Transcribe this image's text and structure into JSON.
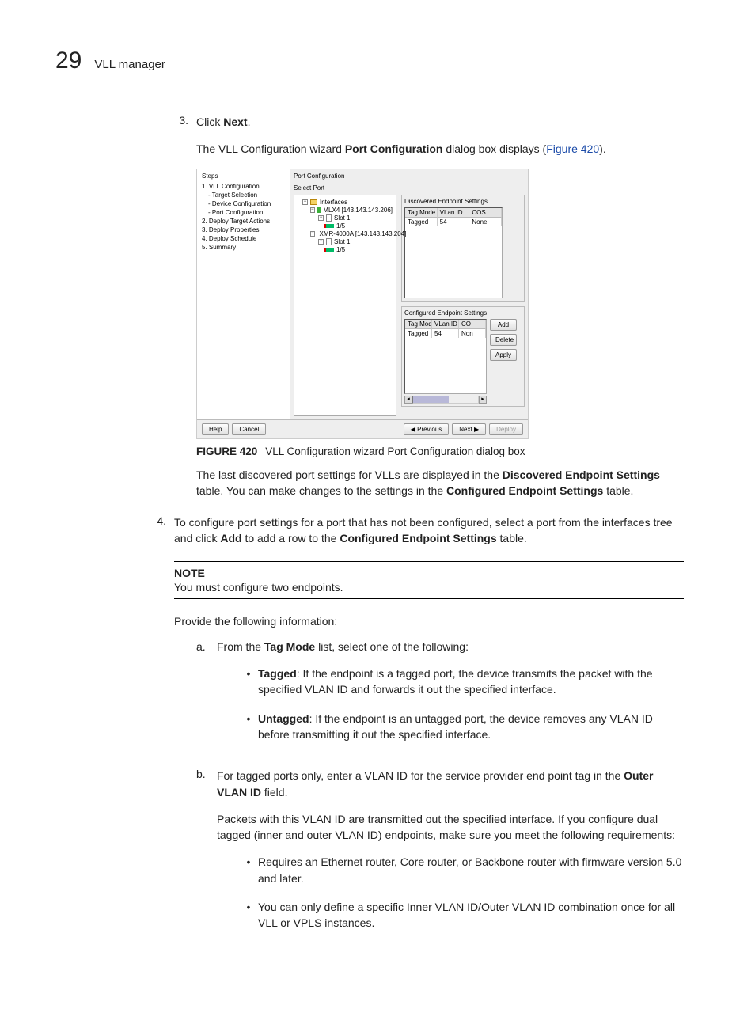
{
  "header": {
    "number": "29",
    "title": "VLL manager"
  },
  "step3": {
    "num": "3.",
    "line1_prefix": "Click ",
    "line1_bold": "Next",
    "line1_suffix": ".",
    "line2_a": "The VLL Configuration wizard ",
    "line2_b": "Port Configuration",
    "line2_c": " dialog box displays (",
    "line2_link": "Figure 420",
    "line2_d": ")."
  },
  "screenshot": {
    "steps_title": "Steps",
    "steps": [
      "1. VLL Configuration",
      "- Target Selection",
      "- Device Configuration",
      "- Port Configuration",
      "2. Deploy Target Actions",
      "3. Deploy Properties",
      "4. Deploy Schedule",
      "5. Summary"
    ],
    "right_title": "Port Configuration",
    "select_port": "Select Port",
    "tree": {
      "root": "Interfaces",
      "dev1": "MLX4 [143.143.143.206]",
      "slot1a": "Slot 1",
      "port1a": "1/5",
      "dev2": "XMR-4000A [143.143.143.204]",
      "slot1b": "Slot 1",
      "port1b": "1/5"
    },
    "disc_title": "Discovered Endpoint Settings",
    "conf_title": "Configured Endpoint Settings",
    "cols": {
      "tagmode": "Tag Mode",
      "vlanid": "VLan ID",
      "cos": "COS",
      "co": "CO"
    },
    "row": {
      "tagmode": "Tagged",
      "vlanid": "54",
      "cos": "None",
      "co": "Non"
    },
    "btns": {
      "add": "Add",
      "delete": "Delete",
      "apply": "Apply"
    },
    "bottom": {
      "help": "Help",
      "cancel": "Cancel",
      "prev": "◀ Previous",
      "next": "Next ▶",
      "deploy": "Deploy"
    }
  },
  "figcaption": {
    "num": "FIGURE 420",
    "text": "VLL Configuration wizard Port Configuration dialog box"
  },
  "para_after_fig": {
    "a": "The last discovered port settings for VLLs are displayed in the ",
    "b": "Discovered Endpoint Settings",
    "c": " table. You can make changes to the settings in the ",
    "d": "Configured Endpoint Settings",
    "e": " table."
  },
  "step4": {
    "num": "4.",
    "a": "To configure port settings for a port that has not been configured, select a port from the interfaces tree and click ",
    "b": "Add",
    "c": " to add a row to the ",
    "d": "Configured Endpoint Settings",
    "e": " table."
  },
  "note": {
    "title": "NOTE",
    "text": "You must configure two endpoints."
  },
  "provide": "Provide the following information:",
  "sub_a": {
    "letter": "a.",
    "a": "From the ",
    "b": "Tag Mode",
    "c": " list, select one of the following:"
  },
  "bullet_tagged": {
    "b": "Tagged",
    "t": ": If the endpoint is a tagged port, the device transmits the packet with the specified VLAN ID and forwards it out the specified interface."
  },
  "bullet_untagged": {
    "b": "Untagged",
    "t": ": If the endpoint is an untagged port, the device removes any VLAN ID before transmitting it out the specified interface."
  },
  "sub_b": {
    "letter": "b.",
    "a": "For tagged ports only, enter a VLAN ID for the service provider end point tag in the ",
    "b": "Outer VLAN ID",
    "c": " field.",
    "p2": "Packets with this VLAN ID are transmitted out the specified interface. If you configure dual tagged (inner and outer VLAN ID) endpoints, make sure you meet the following requirements:",
    "b1": "Requires an Ethernet router, Core router, or Backbone router with firmware version 5.0 and later.",
    "b2": "You can only define a specific Inner VLAN ID/Outer VLAN ID combination once for all VLL or VPLS instances."
  }
}
